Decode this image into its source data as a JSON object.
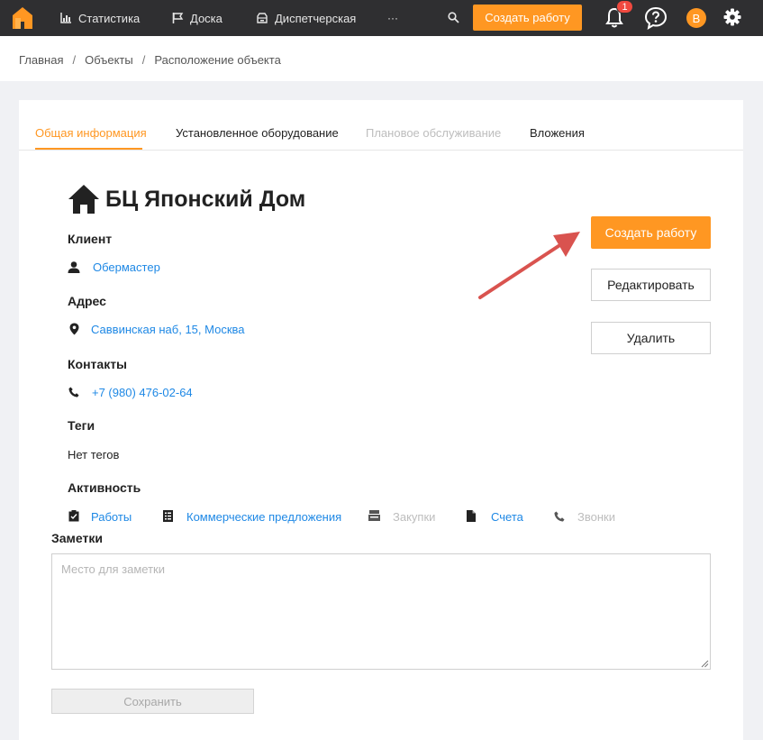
{
  "nav": {
    "items": [
      {
        "label": "Статистика",
        "icon": "chart-icon"
      },
      {
        "label": "Доска",
        "icon": "board-icon"
      },
      {
        "label": "Диспетчерская",
        "icon": "dispatch-icon"
      }
    ],
    "more": "···",
    "create_label": "Создать работу",
    "notifications_count": "1",
    "avatar_letter": "В",
    "accent": "#ff9722",
    "bar_color": "#2f2f31"
  },
  "breadcrumb": [
    "Главная",
    "Объекты",
    "Расположение объекта"
  ],
  "tabs": [
    {
      "label": "Общая информация",
      "state": "active"
    },
    {
      "label": "Установленное оборудование",
      "state": "normal"
    },
    {
      "label": "Плановое обслуживание",
      "state": "disabled"
    },
    {
      "label": "Вложения",
      "state": "normal"
    }
  ],
  "object": {
    "title": "БЦ Японский Дом",
    "client_label": "Клиент",
    "client": "Обермастер",
    "address_label": "Адрес",
    "address": "Саввинская наб, 15, Москва",
    "contacts_label": "Контакты",
    "phone": "+7 (980) 476-02-64",
    "tags_label": "Теги",
    "tags": "Нет тегов",
    "activity_label": "Активность",
    "activity": [
      {
        "label": "Работы",
        "icon": "checklist-icon",
        "state": "link"
      },
      {
        "label": "Коммерческие предложения",
        "icon": "document-list-icon",
        "state": "link"
      },
      {
        "label": "Закупки",
        "icon": "cash-register-icon",
        "state": "disabled"
      },
      {
        "label": "Счета",
        "icon": "file-icon",
        "state": "link"
      },
      {
        "label": "Звонки",
        "icon": "phone-icon",
        "state": "disabled"
      }
    ]
  },
  "actions": {
    "create": "Создать работу",
    "edit": "Редактировать",
    "delete": "Удалить"
  },
  "notes": {
    "label": "Заметки",
    "placeholder": "Место для заметки",
    "value": "",
    "save": "Сохранить"
  }
}
